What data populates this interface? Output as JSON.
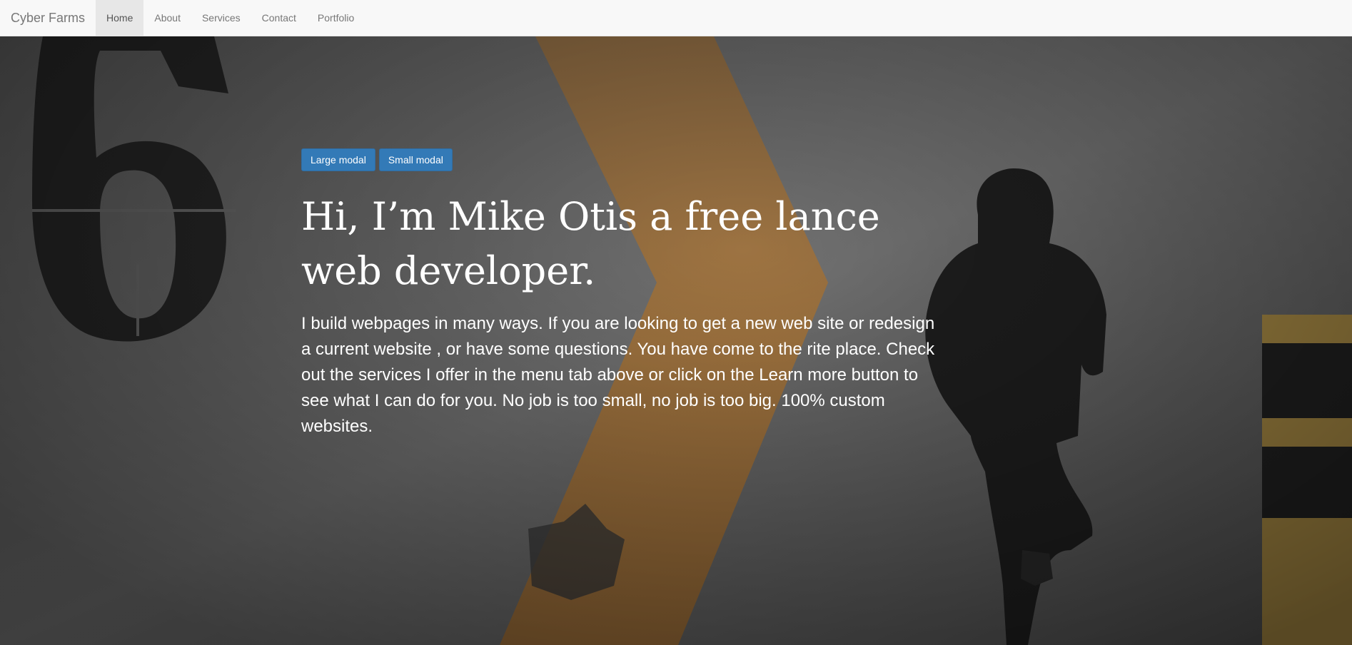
{
  "nav": {
    "brand": "Cyber Farms",
    "items": [
      {
        "label": "Home",
        "active": true
      },
      {
        "label": "About",
        "active": false
      },
      {
        "label": "Services",
        "active": false
      },
      {
        "label": "Contact",
        "active": false
      },
      {
        "label": "Portfolio",
        "active": false
      }
    ]
  },
  "hero": {
    "buttons": {
      "large_modal": "Large modal",
      "small_modal": "Small modal"
    },
    "headline": "Hi, I’m Mike Otis a free lance web developer.",
    "intro": "I build webpages in many ways. If you are looking to get a new web site or redesign a current website , or have some questions. You have come to the rite place. Check out the services I offer in the menu tab above or click on the Learn more button to see what I can do for you. No job is too small, no job is too big. 100% custom websites.",
    "background_icon": "wall-photo-person-leaning",
    "background_text": "6"
  },
  "colors": {
    "navbar_bg": "#f8f8f8",
    "button_primary": "#337ab7",
    "stripe_orange": "#c98a3e",
    "wall_gray": "#6e6e6e"
  }
}
